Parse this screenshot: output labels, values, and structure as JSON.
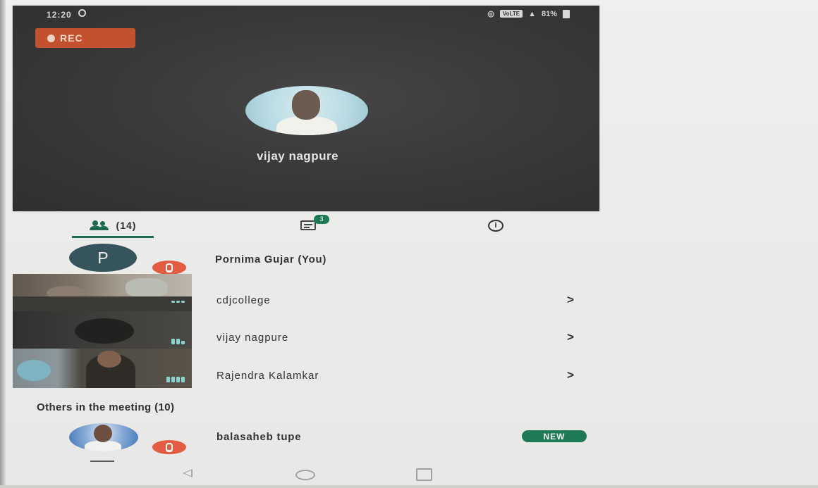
{
  "status_bar": {
    "time": "12:20",
    "indicators": "VoLTE",
    "battery": "81%"
  },
  "recording_badge": "REC",
  "speaker": {
    "name": "vijay nagpure"
  },
  "tabs": {
    "participants_count": "(14)",
    "chat_badge": "3"
  },
  "participants": {
    "self": {
      "initial": "P",
      "name": "Pornima Gujar (You)"
    },
    "remote": [
      {
        "name": "cdjcollege",
        "chevron": ">"
      },
      {
        "name": "vijay nagpure",
        "chevron": ">"
      },
      {
        "name": "Rajendra Kalamkar",
        "chevron": ">"
      }
    ]
  },
  "others": {
    "header": "Others in the meeting (10)",
    "items": [
      {
        "name": "balasaheb tupe",
        "badge": "NEW"
      }
    ]
  },
  "colors": {
    "accent_green": "#1e7a56",
    "mute_red": "#e25b43",
    "rec_orange": "#c2512d",
    "video_bg": "#3a3a3a"
  },
  "icons": [
    "people-icon",
    "chat-icon",
    "info-icon",
    "mic-off-icon",
    "back-nav-icon",
    "home-nav-icon",
    "recent-apps-icon"
  ]
}
